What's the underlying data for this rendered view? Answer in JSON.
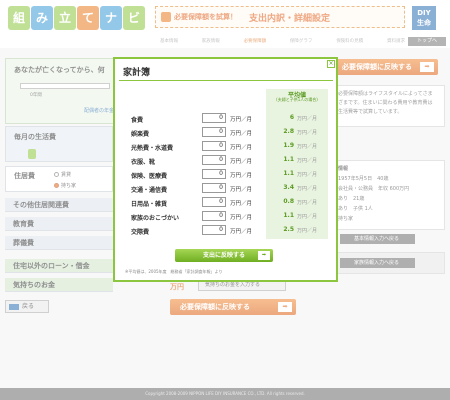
{
  "header": {
    "logo_chars": [
      "組",
      "み",
      "立",
      "て",
      "ナ",
      "ビ"
    ],
    "logo_colors": [
      "#8cc63f",
      "#3d9bd8",
      "#8cc63f",
      "#e97a22",
      "#3d9bd8",
      "#8cc63f"
    ],
    "banner_small": "必要保障額を試算！",
    "banner_large": "支出内訳・詳細設定",
    "diy_line1": "DIY",
    "diy_line2": "生命",
    "steps": [
      "基本情報",
      "家族情報",
      "必要保障額",
      "保障グラフ",
      "保険料の見積",
      "資料請求"
    ],
    "active_step": 2,
    "top_link": "トップへ"
  },
  "left": {
    "death_title": "あなたが亡くなってから、何",
    "slider_min": "0年間",
    "recalc_link": "配偶者の年金額を",
    "monthly_title": "毎月の生活費",
    "housing_title": "住居費",
    "radio_rent": "賃貸",
    "radio_own": "持ち家",
    "rows": [
      "その他住居関連費",
      "教育費",
      "葬儀費",
      "住宅以外のローン・借金",
      "気持ちのお金"
    ],
    "feelings_unit": "万円",
    "feelings_button": "気持ちのお金を入力する",
    "back_button": "戻る",
    "top_reflect_button": "必要保障額に反映する",
    "bottom_reflect_button": "必要保障額に反映する"
  },
  "right": {
    "info_text": "必要保障額はライフスタイルによってさまざまです。住まいに関わる費用や教育費は生活費等で試算しています。",
    "profile_title": "情報",
    "profile_lines": [
      "1957年5月5日　40歳",
      "会社員・公務員　年収 600万円",
      "あり　21歳",
      "あり　子供 1人",
      "持ち家"
    ],
    "basic_button": "基本情報入力へ戻る",
    "family_button": "家族情報入力へ戻る"
  },
  "modal": {
    "title": "家計簿",
    "close_label": "×",
    "avg_header": "平均値",
    "avg_sub": "(夫婦と子供1人の場合)",
    "unit_label": "万円／月",
    "items": [
      {
        "label": "食費",
        "value": "0",
        "avg": "6"
      },
      {
        "label": "娯楽費",
        "value": "0",
        "avg": "2.8"
      },
      {
        "label": "光熱費・水道費",
        "value": "0",
        "avg": "1.9"
      },
      {
        "label": "衣服、靴",
        "value": "0",
        "avg": "1.1"
      },
      {
        "label": "保険、医療費",
        "value": "0",
        "avg": "1.1"
      },
      {
        "label": "交通・通信費",
        "value": "0",
        "avg": "3.4"
      },
      {
        "label": "日用品・雑貨",
        "value": "0",
        "avg": "0.8"
      },
      {
        "label": "家族のおこづかい",
        "value": "0",
        "avg": "1.1"
      },
      {
        "label": "交際費",
        "value": "0",
        "avg": "2.5"
      }
    ],
    "reflect_button": "支出に反映する",
    "note": "※平均値は、2005年度　総務省「家計調査年報」より"
  },
  "footer": {
    "copyright": "Copyright 2008-2009 NIPPON LIFE DIY INSURANCE CO., LTD. All rights reserved."
  }
}
